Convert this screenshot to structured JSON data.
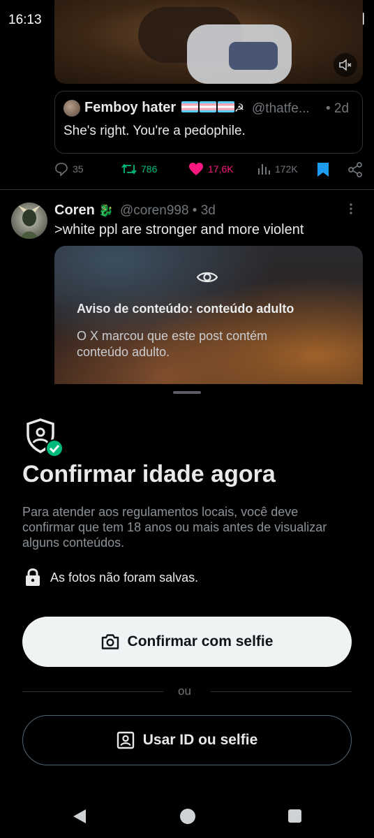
{
  "status_bar": {
    "time": "16:13"
  },
  "quote": {
    "name": "Femboy hater",
    "name_suffix": "☭",
    "handle": "@thatfe...",
    "time": "• 2d",
    "text": "She's right. You're a pedophile."
  },
  "actions": {
    "replies": "35",
    "retweets": "786",
    "likes": "17,6K",
    "views": "172K"
  },
  "tweet": {
    "name": "Coren",
    "name_emoji": "🐉",
    "handle": "@coren998 • 3d",
    "text": ">white ppl are stronger and more violent",
    "warning_title": "Aviso de conteúdo: conteúdo adulto",
    "warning_text": "O X marcou que este post contém conteúdo adulto."
  },
  "sheet": {
    "title": "Confirmar idade agora",
    "description": "Para atender aos regulamentos locais, você deve confirmar que tem 18 anos ou mais antes de visualizar alguns conteúdos.",
    "privacy_note": "As fotos não foram salvas.",
    "primary_button": "Confirmar com selfie",
    "or_label": "ou",
    "secondary_button": "Usar ID ou selfie"
  },
  "colors": {
    "like": "#f91880",
    "retweet": "#00ba7c",
    "bookmark": "#1d9bf0",
    "verified_check": "#00ba7c"
  },
  "icons": [
    "dnd-icon",
    "wifi-icon",
    "signal-icon",
    "battery-icon",
    "mute-icon",
    "reply-icon",
    "retweet-icon",
    "heart-icon",
    "views-icon",
    "bookmark-icon",
    "share-icon",
    "eye-icon",
    "shield-check-icon",
    "lock-icon",
    "camera-icon",
    "id-card-icon"
  ]
}
